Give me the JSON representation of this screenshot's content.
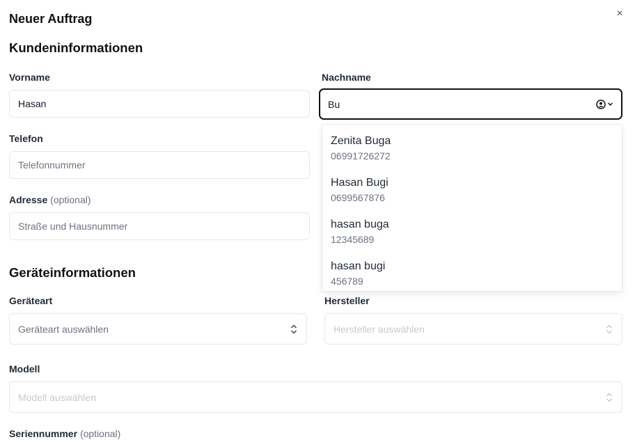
{
  "dialog": {
    "title": "Neuer Auftrag",
    "close_glyph": "×"
  },
  "customer": {
    "section_title": "Kundeninformationen",
    "first_name": {
      "label": "Vorname",
      "value": "Hasan"
    },
    "last_name": {
      "label": "Nachname",
      "value": "Bu"
    },
    "phone": {
      "label": "Telefon",
      "placeholder": "Telefonnummer"
    },
    "address": {
      "label": "Adresse",
      "optional": "(optional)",
      "placeholder": "Straße und Hausnummer"
    }
  },
  "suggestions": [
    {
      "name": "Zenita Buga",
      "phone": "06991726272"
    },
    {
      "name": "Hasan Bugi",
      "phone": "0699567876"
    },
    {
      "name": "hasan buga",
      "phone": "12345689"
    },
    {
      "name": "hasan bugi",
      "phone": "456789"
    }
  ],
  "device": {
    "section_title": "Geräteinformationen",
    "type": {
      "label": "Geräteart",
      "placeholder": "Geräteart auswählen"
    },
    "manufacturer": {
      "label": "Hersteller",
      "placeholder": "Hersteller auswählen"
    },
    "model": {
      "label": "Modell",
      "placeholder": "Modell auswählen"
    },
    "serial": {
      "label": "Seriennummer",
      "optional": "(optional)"
    }
  },
  "colors": {
    "focus_border": "#111111",
    "input_border": "#e5e7eb",
    "muted_text": "#6b7280"
  }
}
